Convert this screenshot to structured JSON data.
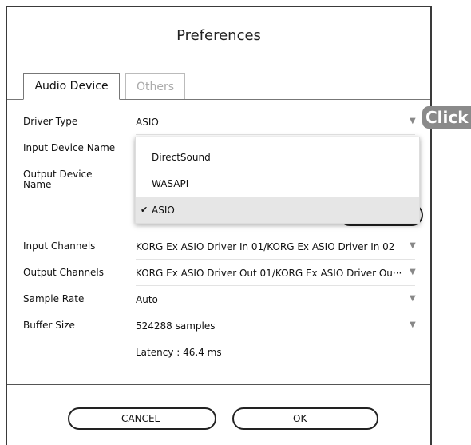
{
  "dialog": {
    "title": "Preferences"
  },
  "tabs": [
    {
      "label": "Audio Device",
      "active": true
    },
    {
      "label": "Others",
      "active": false
    }
  ],
  "fields": {
    "driver_type": {
      "label": "Driver Type",
      "value": "ASIO"
    },
    "input_device": {
      "label": "Input Device Name"
    },
    "output_device": {
      "label": "Output Device Name"
    },
    "input_channels": {
      "label": "Input Channels",
      "value": "KORG Ex ASIO Driver In 01/KORG Ex ASIO Driver In 02"
    },
    "output_channels": {
      "label": "Output Channels",
      "value": "KORG Ex ASIO Driver Out 01/KORG Ex ASIO Driver Ou···"
    },
    "sample_rate": {
      "label": "Sample Rate",
      "value": "Auto"
    },
    "buffer_size": {
      "label": "Buffer Size",
      "value": "524288 samples"
    },
    "latency": "Latency : 46.4 ms"
  },
  "driver_dropdown": {
    "options": [
      "DirectSound",
      "WASAPI",
      "ASIO"
    ],
    "selected": "ASIO",
    "check_glyph": "✔"
  },
  "buttons": {
    "cancel": "CANCEL",
    "ok": "OK"
  },
  "annotation": {
    "click_label": "Click"
  },
  "icons": {
    "dropdown_arrow": "▼"
  },
  "colors": {
    "border": "#3a3a3a",
    "inactive_tab": "#aaaaaa",
    "selected_option": "#e6e6e6",
    "badge": "#8a8a8a"
  }
}
